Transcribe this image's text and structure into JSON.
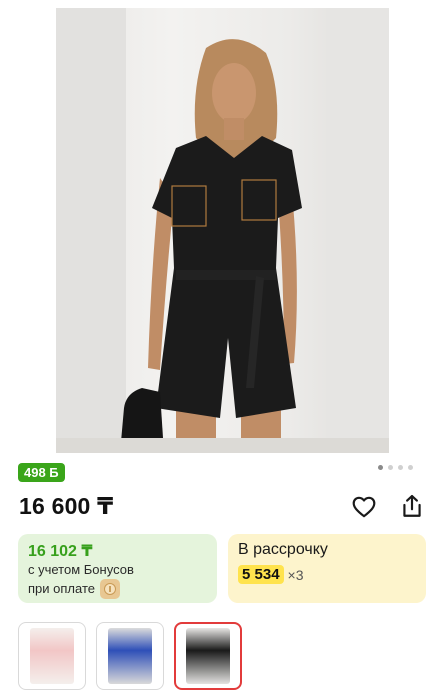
{
  "product": {
    "bonus_badge": "498 Б",
    "price": "16 600 ₸",
    "image_dots": 4,
    "active_dot": 0
  },
  "bonus_card": {
    "amount": "16 102 ₸",
    "line1": "с учетом Бонусов",
    "line2": "при оплате"
  },
  "installment_card": {
    "title": "В рассрочку",
    "amount": "5 534",
    "multiplier": "×3"
  },
  "thumbnails": [
    {
      "name": "pink",
      "color": "#f2c6c6",
      "selected": false
    },
    {
      "name": "blue",
      "color": "#2e4fb8",
      "selected": false
    },
    {
      "name": "black",
      "color": "#1a1a1a",
      "selected": true
    }
  ],
  "colors": {
    "bonus_green": "#3aa51a",
    "installment_yellow": "#ffe34d",
    "selected_border": "#e23b3b"
  },
  "icons": {
    "favorite": "heart-icon",
    "share": "share-icon",
    "bonus_coin": "coin-icon"
  }
}
